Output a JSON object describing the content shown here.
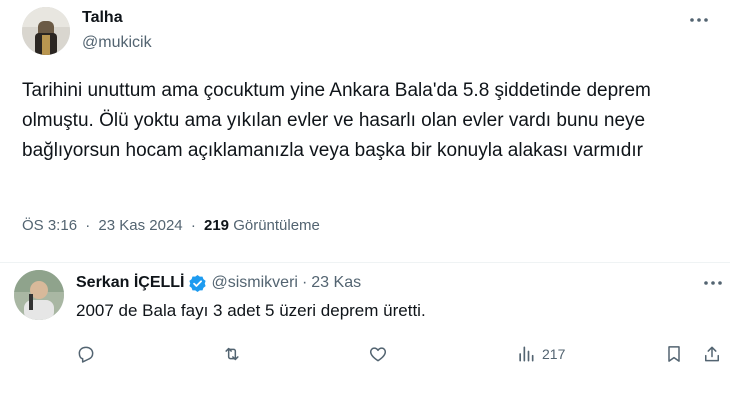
{
  "tweet": {
    "author_name": "Talha",
    "author_handle": "@mukicik",
    "text": "Tarihini unuttum ama çocuktum yine Ankara Bala'da 5.8 şiddetinde deprem olmuştu. Ölü yoktu ama yıkılan evler ve hasarlı olan evler vardı bunu neye bağlıyorsun hocam açıklamanızla veya başka bir konuyla alakası varmıdır",
    "time": "ÖS 3:16",
    "dot": "·",
    "date": "23 Kas 2024",
    "views_count": "219",
    "views_label": "Görüntüleme",
    "more_icon": "more-horizontal-icon"
  },
  "reply": {
    "author_name": "Serkan İÇELLİ",
    "verified_icon": "verified-badge-icon",
    "verified_color": "#1d9bf0",
    "author_handle": "@sismikveri",
    "dot": "·",
    "date": "23 Kas",
    "text": "2007 de Bala fayı 3 adet 5 üzeri deprem üretti.",
    "actions": {
      "reply_icon": "reply-icon",
      "retweet_icon": "retweet-icon",
      "like_icon": "heart-icon",
      "views_icon": "views-bar-chart-icon",
      "views_count": "217",
      "bookmark_icon": "bookmark-icon",
      "share_icon": "share-icon"
    }
  },
  "colors": {
    "primary_text": "#0f1419",
    "secondary_text": "#536471",
    "divider": "#eff3f4",
    "accent": "#1d9bf0"
  }
}
